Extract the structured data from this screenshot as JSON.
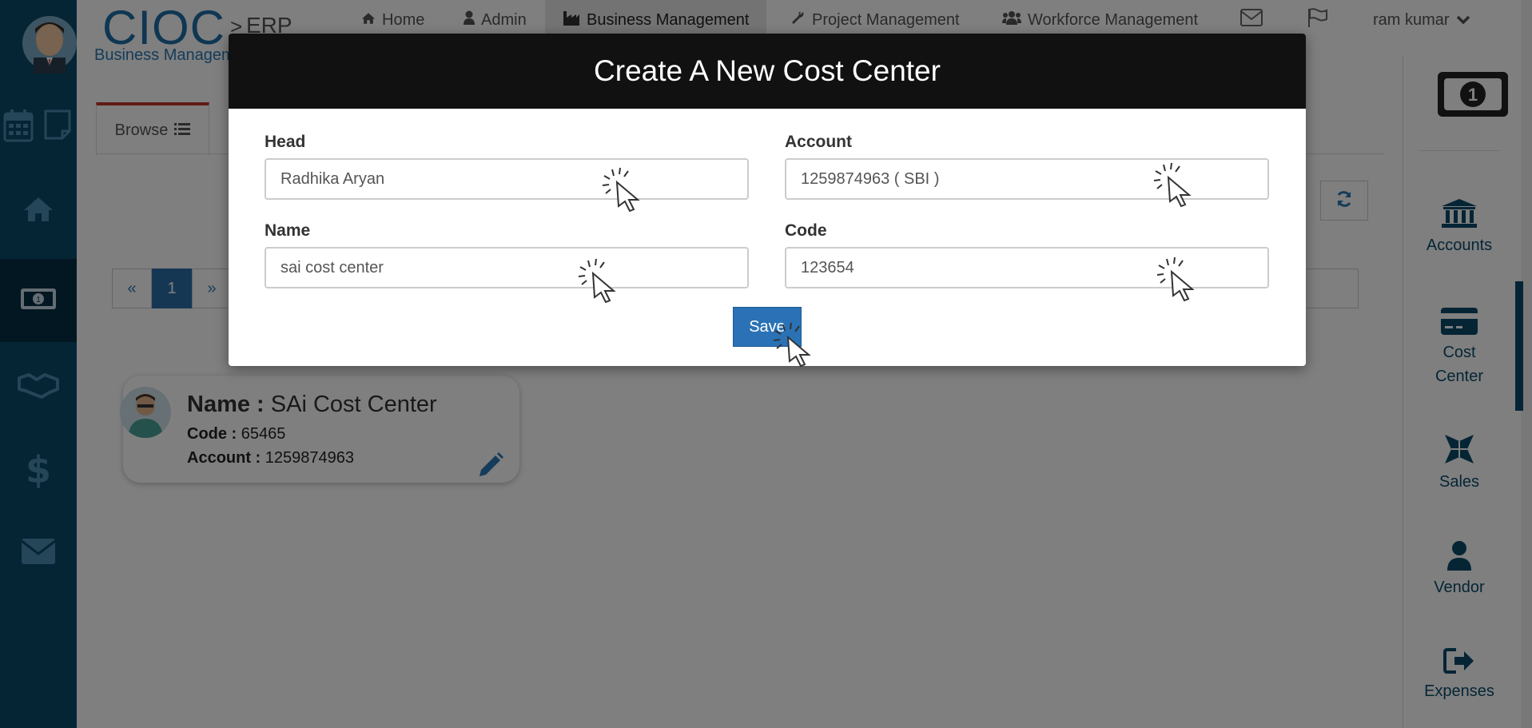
{
  "brand": {
    "name": "CIOC",
    "sub": "ERP",
    "separator": ">"
  },
  "breadcrumb": "Business Management",
  "nav": [
    {
      "label": "Home",
      "icon": "home-icon"
    },
    {
      "label": "Admin",
      "icon": "user-icon"
    },
    {
      "label": "Business Management",
      "icon": "industry-icon",
      "active": true
    },
    {
      "label": "Project Management",
      "icon": "wrench-icon"
    },
    {
      "label": "Workforce Management",
      "icon": "users-icon"
    }
  ],
  "user": {
    "name": "ram kumar"
  },
  "left_sidebar": [
    "calendar-icon",
    "note-icon",
    "home-icon",
    "money-icon",
    "handshake-icon",
    "dollar-icon",
    "envelope-icon"
  ],
  "right_sidebar": [
    {
      "label": "Accounts",
      "icon": "bank-icon"
    },
    {
      "label": "Cost Center",
      "icon": "credit-card-icon"
    },
    {
      "label": "Sales",
      "icon": "sales-icon"
    },
    {
      "label": "Vendor",
      "icon": "user-icon"
    },
    {
      "label": "Expenses",
      "icon": "sign-out-icon"
    }
  ],
  "tabs": {
    "browse": "Browse"
  },
  "pager": {
    "prev": "«",
    "page": "1",
    "next": "»"
  },
  "card": {
    "name_label": "Name :",
    "name": "SAi Cost Center",
    "code_label": "Code :",
    "code": "65465",
    "account_label": "Account :",
    "account": "1259874963"
  },
  "modal": {
    "title": "Create A New Cost Center",
    "head_label": "Head",
    "head_value": "Radhika Aryan",
    "account_label": "Account",
    "account_value": "1259874963 ( SBI )",
    "name_label": "Name",
    "name_value": "sai cost center",
    "code_label": "Code",
    "code_value": "123654",
    "save_label": "Save"
  },
  "colors": {
    "sidebar": "#0b4a6a",
    "accent": "#2a72b5",
    "modal_header": "#111111"
  }
}
